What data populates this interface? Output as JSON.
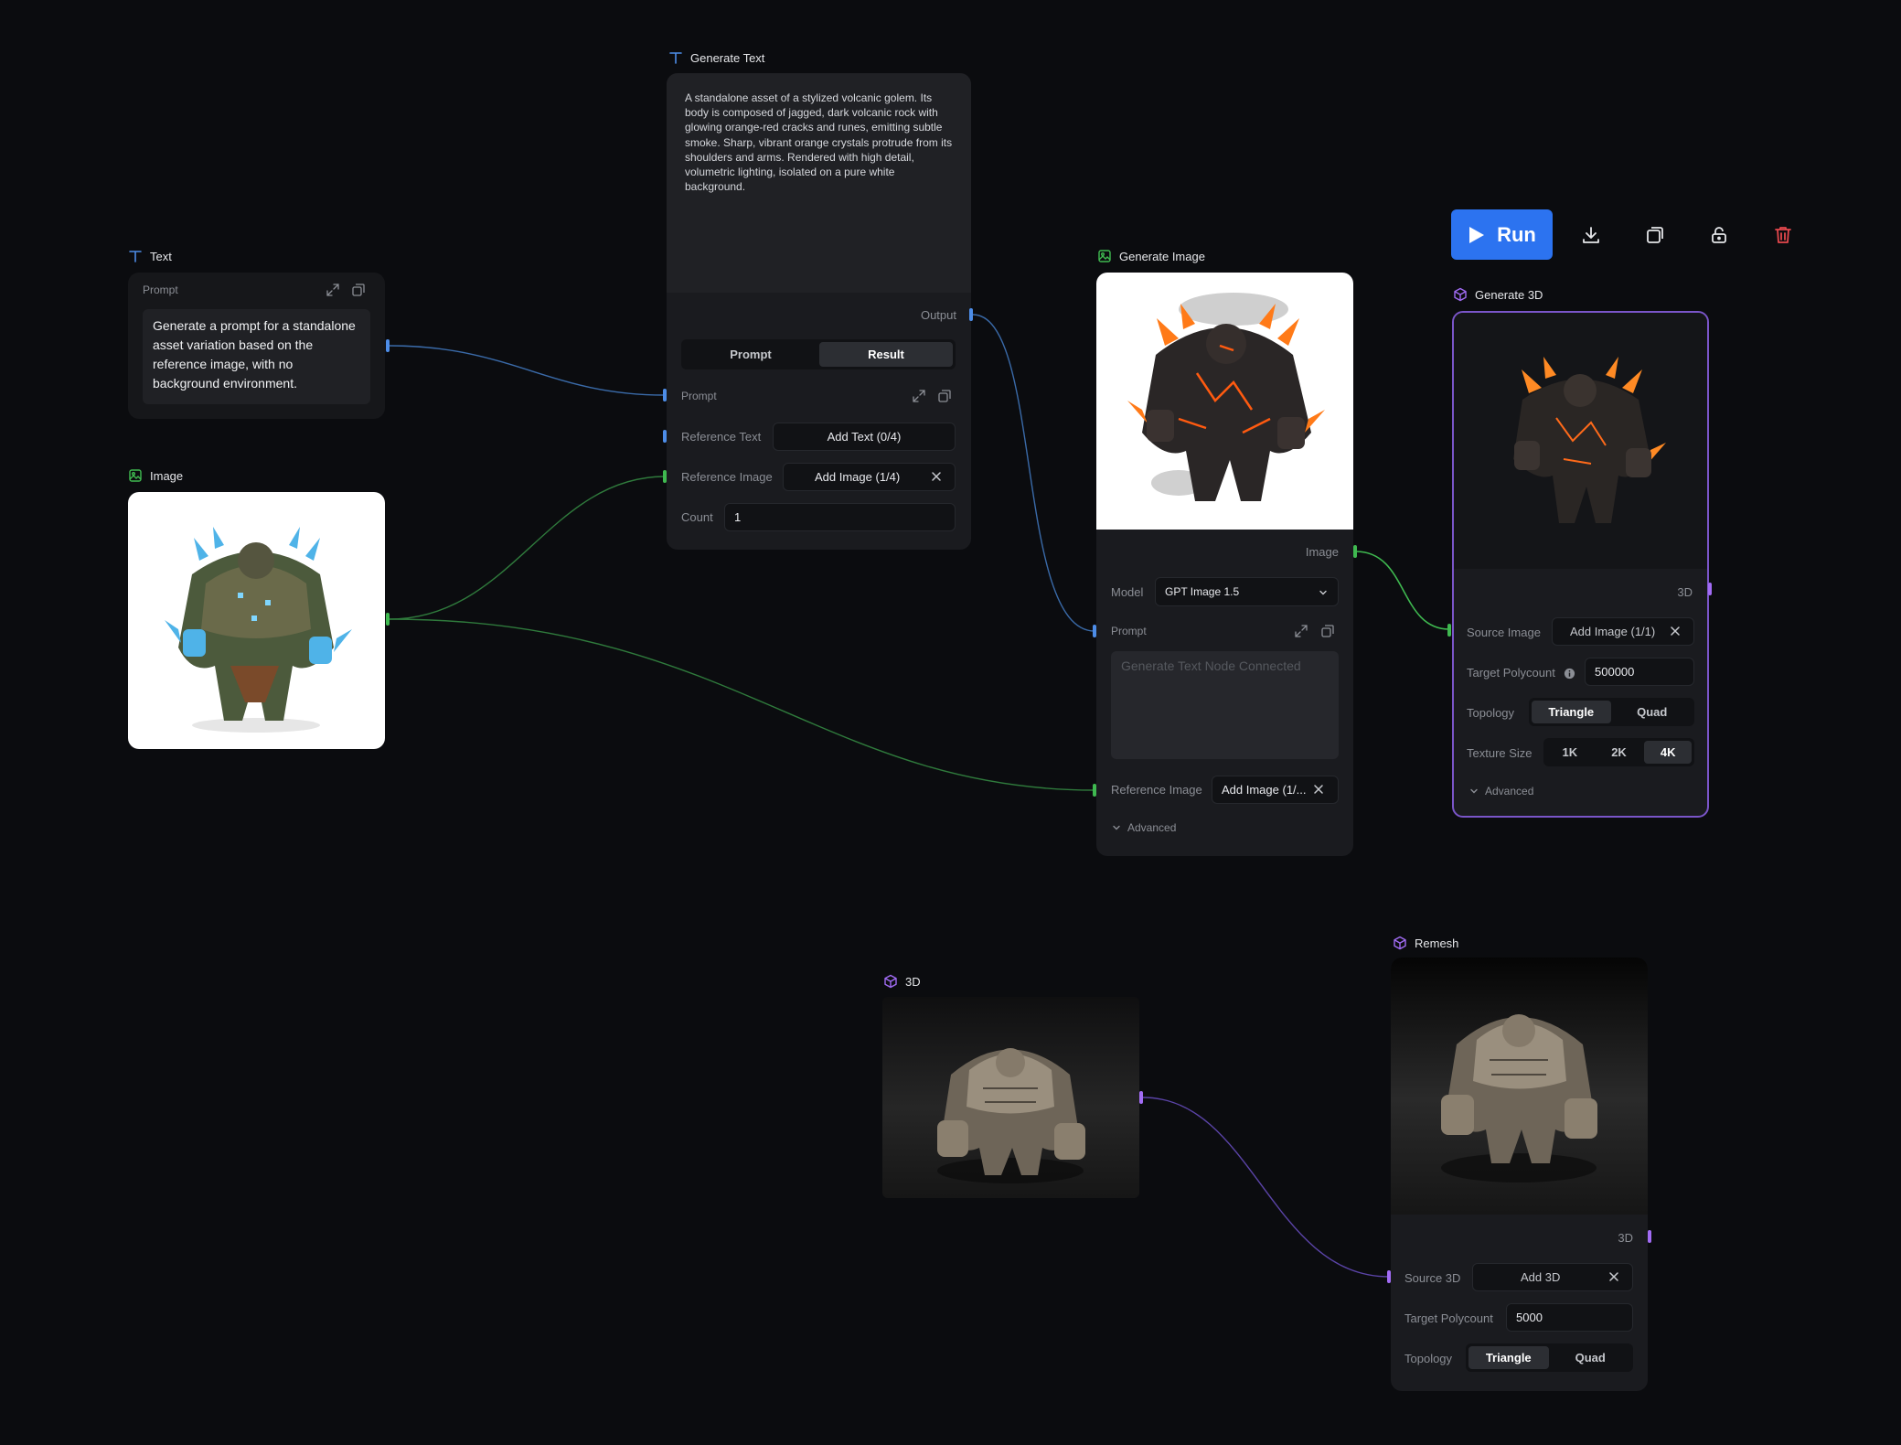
{
  "toolbar": {
    "run_label": "Run"
  },
  "text_node": {
    "title": "Text",
    "prompt_label": "Prompt",
    "prompt_value": "Generate a prompt for a standalone asset variation based on the reference image, with no background environment."
  },
  "image_node": {
    "title": "Image"
  },
  "generate_text_node": {
    "title": "Generate Text",
    "result_text": "A standalone asset of a stylized volcanic golem. Its body is composed of jagged, dark volcanic rock with glowing orange-red cracks and runes, emitting subtle smoke. Sharp, vibrant orange crystals protrude from its shoulders and arms. Rendered with high detail, volumetric lighting, isolated on a pure white background.",
    "output_label": "Output",
    "tabs": [
      "Prompt",
      "Result"
    ],
    "active_tab": "Result",
    "prompt_label": "Prompt",
    "reference_text_label": "Reference Text",
    "reference_text_button": "Add Text (0/4)",
    "reference_image_label": "Reference Image",
    "reference_image_button": "Add Image (1/4)",
    "count_label": "Count",
    "count_value": "1"
  },
  "generate_image_node": {
    "title": "Generate Image",
    "image_output_label": "Image",
    "model_label": "Model",
    "model_value": "GPT Image 1.5",
    "prompt_label": "Prompt",
    "prompt_placeholder": "Generate Text Node Connected",
    "reference_image_label": "Reference Image",
    "reference_image_button": "Add Image (1/...",
    "advanced_label": "Advanced"
  },
  "generate_3d_node": {
    "title": "Generate 3D",
    "output_label": "3D",
    "source_image_label": "Source Image",
    "source_image_button": "Add Image (1/1)",
    "target_polycount_label": "Target Polycount",
    "target_polycount_value": "500000",
    "topology_label": "Topology",
    "topology_options": [
      "Triangle",
      "Quad"
    ],
    "topology_selected": "Triangle",
    "texture_size_label": "Texture Size",
    "texture_options": [
      "1K",
      "2K",
      "4K"
    ],
    "texture_selected": "4K",
    "advanced_label": "Advanced"
  },
  "three_d_node": {
    "title": "3D"
  },
  "remesh_node": {
    "title": "Remesh",
    "output_label": "3D",
    "source_3d_label": "Source 3D",
    "source_3d_button": "Add 3D",
    "target_polycount_label": "Target Polycount",
    "target_polycount_value": "5000",
    "topology_label": "Topology",
    "topology_options": [
      "Triangle",
      "Quad"
    ],
    "topology_selected": "Triangle"
  },
  "colors": {
    "run_button": "#2c73f0",
    "delete_icon": "#e5484d",
    "text_port": "#4d8de8",
    "image_port": "#3fb950",
    "mesh_port": "#a26cf5"
  }
}
